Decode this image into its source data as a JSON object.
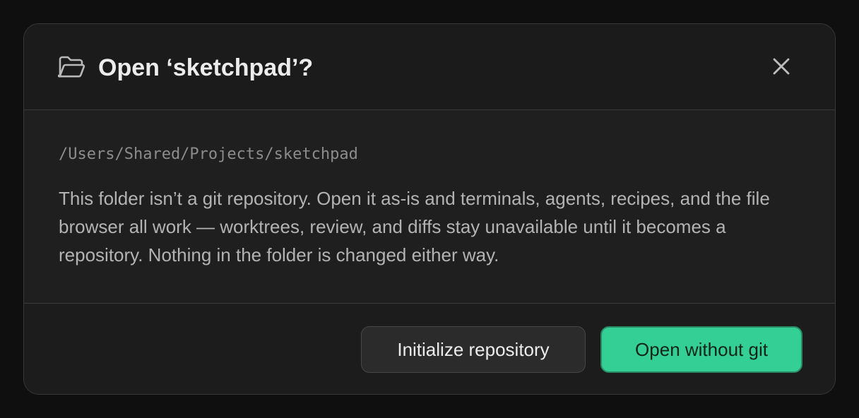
{
  "dialog": {
    "title": "Open ‘sketchpad’?",
    "folder_icon": "folder-open-icon",
    "close_icon": "close-icon",
    "path": "/Users/Shared/Projects/sketchpad",
    "description": "This folder isn’t a git repository. Open it as-is and terminals, agents, recipes, and the file browser all work — worktrees, review, and diffs stay unavailable until it becomes a repository. Nothing in the folder is changed either way.",
    "buttons": {
      "initialize_label": "Initialize repository",
      "open_label": "Open without git"
    }
  },
  "colors": {
    "accent": "#34cf94",
    "background": "#1f1f1f",
    "text": "#ececec"
  }
}
